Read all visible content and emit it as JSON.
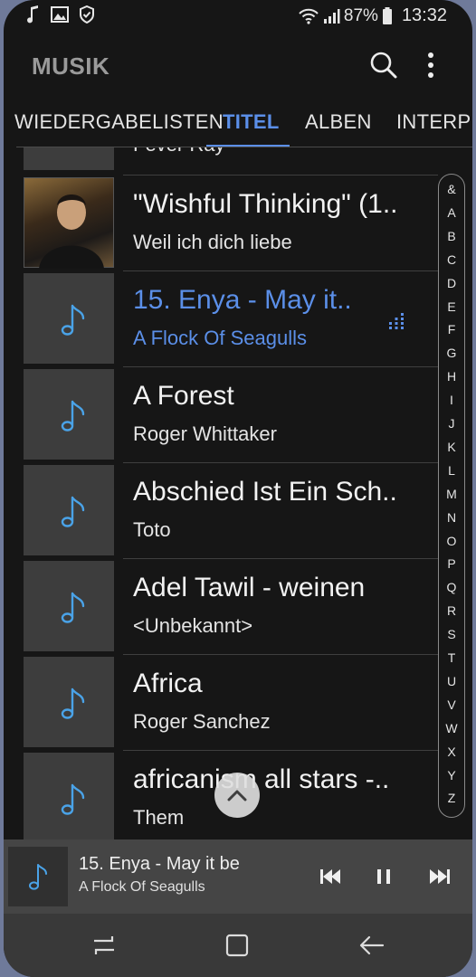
{
  "status": {
    "left_icons": [
      "music-note-icon",
      "image-icon",
      "shield-icon"
    ],
    "battery": "87%",
    "time": "13:32"
  },
  "app": {
    "title": "MUSIK"
  },
  "tabs": [
    {
      "label": "WIEDERGABELISTEN",
      "active": false
    },
    {
      "label": "TITEL",
      "active": true
    },
    {
      "label": "ALBEN",
      "active": false
    },
    {
      "label": "INTERPR",
      "active": false
    }
  ],
  "tracks": [
    {
      "title": "",
      "subtitle": "Fever Ray",
      "playing": false,
      "art": "note"
    },
    {
      "title": "\"Wishful Thinking\" (1..",
      "subtitle": "Weil ich dich liebe",
      "playing": false,
      "art": "photo"
    },
    {
      "title": "15. Enya - May it..",
      "subtitle": "A Flock Of Seagulls",
      "playing": true,
      "art": "note"
    },
    {
      "title": "A Forest",
      "subtitle": "Roger Whittaker",
      "playing": false,
      "art": "note"
    },
    {
      "title": "Abschied Ist Ein Sch..",
      "subtitle": "Toto",
      "playing": false,
      "art": "note"
    },
    {
      "title": "Adel Tawil - weinen",
      "subtitle": "<Unbekannt>",
      "playing": false,
      "art": "note"
    },
    {
      "title": "Africa",
      "subtitle": "Roger Sanchez",
      "playing": false,
      "art": "note"
    },
    {
      "title": "africanism all stars -..",
      "subtitle": "Them",
      "playing": false,
      "art": "note"
    }
  ],
  "alphabet": [
    "&",
    "A",
    "B",
    "C",
    "D",
    "E",
    "F",
    "G",
    "H",
    "I",
    "J",
    "K",
    "L",
    "M",
    "N",
    "O",
    "P",
    "Q",
    "R",
    "S",
    "T",
    "U",
    "V",
    "W",
    "X",
    "Y",
    "Z"
  ],
  "mini_player": {
    "title": "15. Enya - May it be",
    "artist": "A Flock Of Seagulls"
  },
  "colors": {
    "accent": "#5b8fe8",
    "background": "#161616",
    "note": "#4aa3e8"
  }
}
